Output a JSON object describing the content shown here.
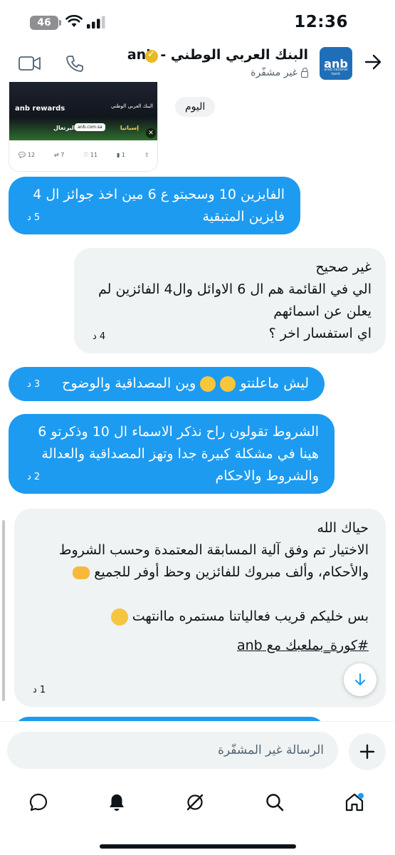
{
  "status_bar": {
    "time": "12:36",
    "battery": "46"
  },
  "header": {
    "title": "البنك العربي الوطني - anb",
    "subtitle": "غير مشفّرة",
    "avatar_text": "anb",
    "avatar_subtext": "arab national bank"
  },
  "tweet_preview": {
    "brand": "anb rewards",
    "brand_ar": "البنك العربي الوطني",
    "team_left": "البرتغال",
    "team_right": "إسبانيا",
    "site": "anb.com.sa",
    "replies": "12",
    "retweets": "7",
    "likes": "11",
    "views": "1"
  },
  "day_chip": "اليوم",
  "messages": [
    {
      "id": "m1",
      "direction": "out",
      "text": "الفايزين 10 وسحبتو ع 6 مين اخذ جوائز ال 4 فايزين المتبقية",
      "time": "5 د"
    },
    {
      "id": "m2",
      "direction": "in",
      "lines": [
        "غير صحيح",
        "الي في القائمة هم ال 6 الاوائل وال4 الفائزين لم يعلن عن اسمائهم",
        "اي استفسار اخر ؟"
      ],
      "time": "4 د"
    },
    {
      "id": "m3",
      "direction": "out",
      "text": "ليش ماعلنتو",
      "text_after": "وين المصداقية والوضوح",
      "time": "3 د"
    },
    {
      "id": "m4",
      "direction": "out",
      "text": "الشروط تقولون راح نذكر الاسماء ال 10 وذكرتو 6 هينا في مشكلة كبيرة جدا وتهز المصداقية والعدالة والشروط والاحكام",
      "time": "2 د"
    },
    {
      "id": "m5",
      "direction": "in",
      "greeting": "حياك الله",
      "body": "الاختيار تم وفق آلية المسابقة المعتمدة وحسب الشروط والأحكام، وألف مبروك للفائزين وحظ أوفر للجميع",
      "line2": "بس خليكم قريب فعالياتنا مستمره ماانتهت",
      "hashtag": "#كورة_بملعبك مع anb",
      "time": "1 د"
    }
  ],
  "composer": {
    "placeholder": "الرسالة غير المشفّرة"
  },
  "nav": [
    "home",
    "search",
    "grok",
    "notifications",
    "messages"
  ]
}
